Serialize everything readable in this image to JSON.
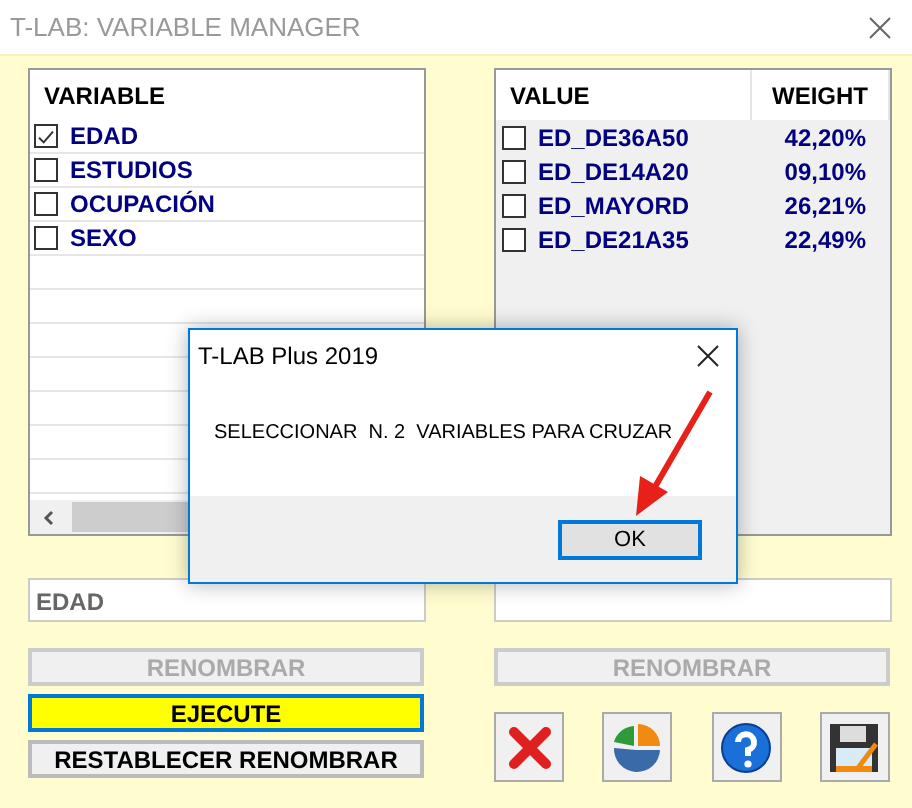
{
  "window": {
    "title": "T-LAB: VARIABLE MANAGER"
  },
  "variables": {
    "header": "VARIABLE",
    "items": [
      {
        "label": "EDAD",
        "checked": true
      },
      {
        "label": "ESTUDIOS",
        "checked": false
      },
      {
        "label": "OCUPACIÓN",
        "checked": false
      },
      {
        "label": "SEXO",
        "checked": false
      }
    ]
  },
  "values": {
    "columns": [
      "VALUE",
      "WEIGHT"
    ],
    "rows": [
      {
        "value": "ED_DE36A50",
        "weight": "42,20%",
        "checked": false
      },
      {
        "value": "ED_DE14A20",
        "weight": "09,10%",
        "checked": false
      },
      {
        "value": "ED_MAYORD",
        "weight": "26,21%",
        "checked": false
      },
      {
        "value": "ED_DE21A35",
        "weight": "22,49%",
        "checked": false
      }
    ]
  },
  "variable_name_field": {
    "value": "EDAD"
  },
  "left_buttons": [
    {
      "label": "RENOMBRAR",
      "disabled": true,
      "kind": "plain"
    },
    {
      "label": "EJECUTE",
      "disabled": false,
      "kind": "highlight"
    },
    {
      "label": "RESTABLECER RENOMBRAR",
      "disabled": false,
      "kind": "plain"
    }
  ],
  "right_button": {
    "label": "RENOMBRAR",
    "disabled": true
  },
  "dialog": {
    "title": "T-LAB Plus 2019",
    "message": "SELECCIONAR  N. 2  VARIABLES PARA CRUZAR",
    "button": "OK"
  }
}
